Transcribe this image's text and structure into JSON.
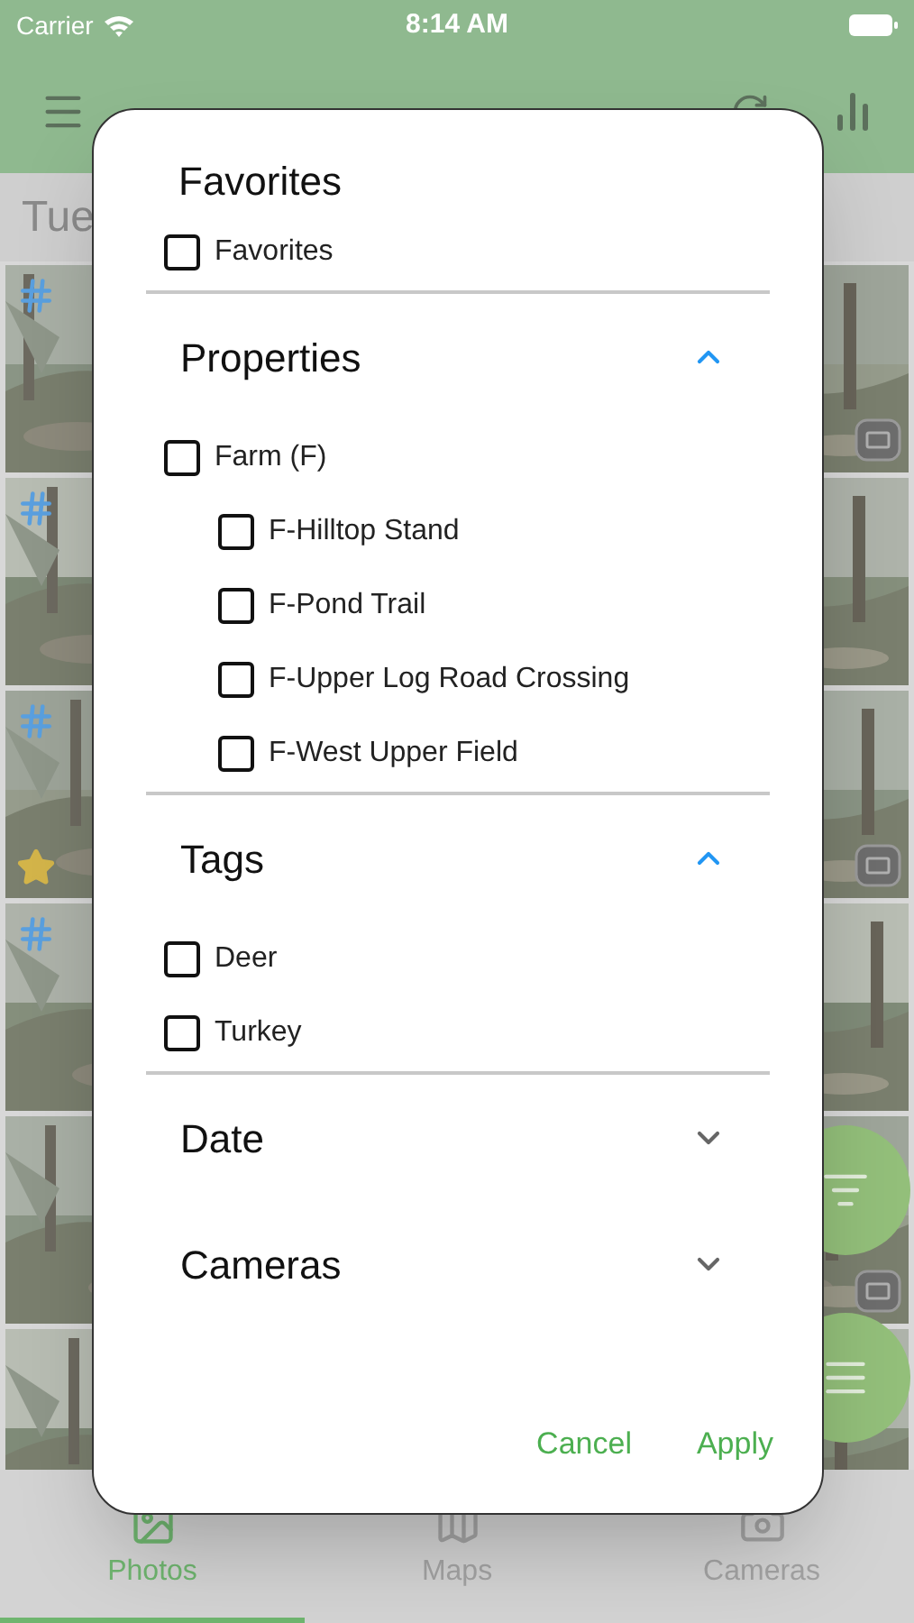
{
  "status_bar": {
    "carrier": "Carrier",
    "time": "8:14 AM"
  },
  "date_header": "Tue",
  "photo_rows": [
    {
      "tagged": true,
      "favorite": false,
      "hd": true
    },
    {
      "tagged": true,
      "favorite": false,
      "hd": false
    },
    {
      "tagged": true,
      "favorite": true,
      "hd": true
    },
    {
      "tagged": true,
      "favorite": false,
      "hd": false
    },
    {
      "tagged": false,
      "favorite": false,
      "hd": true
    },
    {
      "tagged": false,
      "favorite": false,
      "hd": false
    }
  ],
  "tab_bar": [
    {
      "label": "Photos",
      "selected": true
    },
    {
      "label": "Maps",
      "selected": false
    },
    {
      "label": "Cameras",
      "selected": false
    }
  ],
  "dialog": {
    "sections": [
      {
        "kind": "plain",
        "title": "Favorites",
        "options": [
          {
            "label": "Favorites",
            "checked": false
          }
        ]
      },
      {
        "kind": "collapsible",
        "title": "Properties",
        "expanded": true,
        "options": [
          {
            "label": "Farm (F)",
            "checked": false,
            "children": [
              {
                "label": "F-Hilltop Stand",
                "checked": false
              },
              {
                "label": "F-Pond Trail",
                "checked": false
              },
              {
                "label": "F-Upper Log Road Crossing",
                "checked": false
              },
              {
                "label": "F-West Upper Field",
                "checked": false
              }
            ]
          }
        ]
      },
      {
        "kind": "collapsible",
        "title": "Tags",
        "expanded": true,
        "options": [
          {
            "label": "Deer",
            "checked": false
          },
          {
            "label": "Turkey",
            "checked": false
          }
        ]
      },
      {
        "kind": "collapsible",
        "title": "Date",
        "expanded": false
      },
      {
        "kind": "collapsible",
        "title": "Cameras",
        "expanded": false
      }
    ],
    "buttons": [
      "Cancel",
      "Apply"
    ]
  }
}
